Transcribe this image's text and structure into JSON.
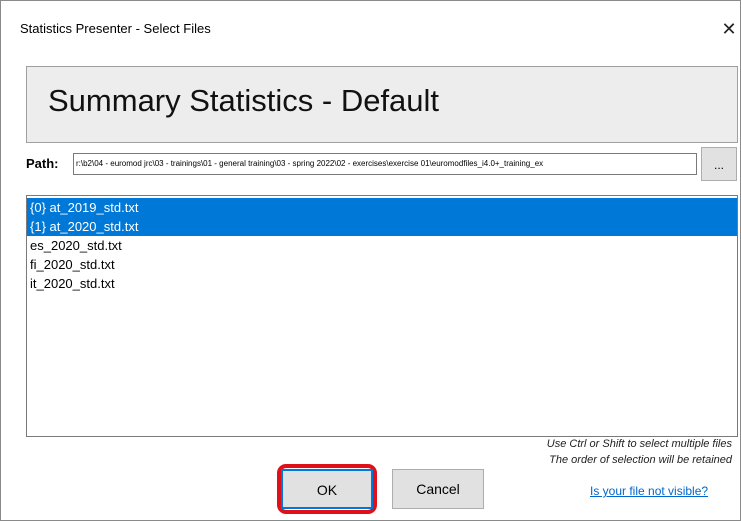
{
  "window": {
    "title": "Statistics Presenter - Select Files",
    "close_glyph": "✕"
  },
  "header": {
    "title": "Summary Statistics - Default"
  },
  "path": {
    "label": "Path:",
    "value": "r:\\b2\\04 - euromod jrc\\03 - trainings\\01 - general training\\03 - spring 2022\\02 - exercises\\exercise 01\\euromodfiles_i4.0+_training_ex",
    "browse_label": "..."
  },
  "files": [
    {
      "label": "{0} at_2019_std.txt",
      "selected": true
    },
    {
      "label": "{1} at_2020_std.txt",
      "selected": true
    },
    {
      "label": "es_2020_std.txt",
      "selected": false
    },
    {
      "label": "fi_2020_std.txt",
      "selected": false
    },
    {
      "label": "it_2020_std.txt",
      "selected": false
    }
  ],
  "hints": {
    "line1": "Use Ctrl or Shift to select multiple files",
    "line2": "The order of selection will be retained"
  },
  "buttons": {
    "ok_label": "OK",
    "cancel_label": "Cancel"
  },
  "link": {
    "label": "Is your file not visible?"
  },
  "colors": {
    "selection": "#0078d7",
    "highlight_annotation": "#e0101a",
    "link": "#0066cc"
  }
}
